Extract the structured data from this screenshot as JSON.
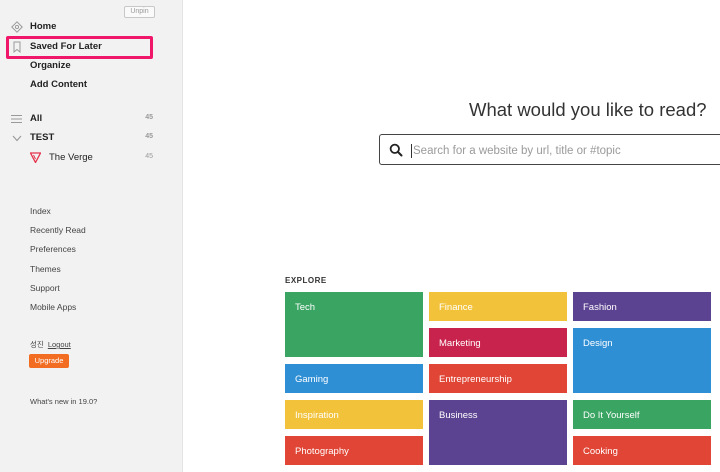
{
  "sidebar": {
    "unpin_label": "Unpin",
    "nav": [
      {
        "label": "Home",
        "icon": "home-icon"
      },
      {
        "label": "Saved For Later",
        "icon": "bookmark-icon"
      },
      {
        "label": "Organize"
      },
      {
        "label": "Add Content"
      }
    ],
    "feeds": [
      {
        "label": "All",
        "count": "45",
        "icon": "list-icon"
      },
      {
        "label": "TEST",
        "count": "45",
        "icon": "chevron-down-icon"
      },
      {
        "label": "The Verge",
        "count": "45",
        "icon": "verge-logo-icon"
      }
    ],
    "links": [
      "Index",
      "Recently Read",
      "Preferences",
      "Themes",
      "Support",
      "Mobile Apps"
    ],
    "user": {
      "name": "성진",
      "logout": "Logout"
    },
    "upgrade_label": "Upgrade",
    "whats_new": "What's new in 19.0?"
  },
  "main": {
    "headline": "What would you like to read?",
    "search": {
      "placeholder": "Search for a website by url, title or #topic",
      "value": ""
    },
    "explore_label": "EXPLORE",
    "tiles": [
      {
        "label": "Tech",
        "color": "#3aa462"
      },
      {
        "label": "Finance",
        "color": "#f2c23a"
      },
      {
        "label": "Fashion",
        "color": "#5c4391"
      },
      {
        "label": "Marketing",
        "color": "#c8234c"
      },
      {
        "label": "Design",
        "color": "#2f8fd5"
      },
      {
        "label": "Gaming",
        "color": "#2f8fd5"
      },
      {
        "label": "Entrepreneurship",
        "color": "#e04535"
      },
      {
        "label": "Inspiration",
        "color": "#f2c23a"
      },
      {
        "label": "Business",
        "color": "#5c4391"
      },
      {
        "label": "Do It Yourself",
        "color": "#3aa462"
      },
      {
        "label": "Photography",
        "color": "#e04535"
      },
      {
        "label": "Cooking",
        "color": "#e04535"
      }
    ]
  },
  "colors": {
    "highlight": "#f0166a",
    "upgrade": "#f26d21",
    "verge": "#e5334b"
  }
}
